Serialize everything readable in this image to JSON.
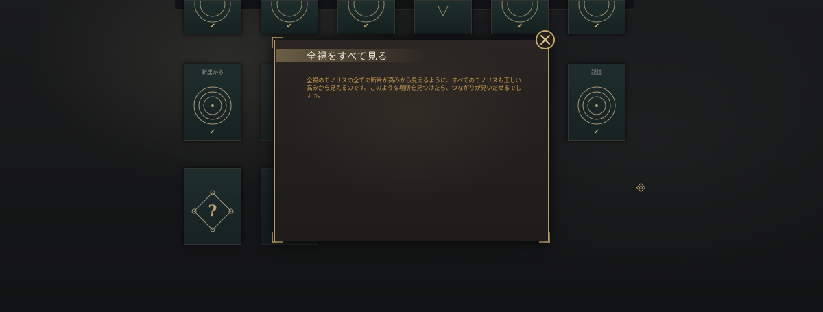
{
  "modal": {
    "title": "全視をすべて見る",
    "body": "全視のモノリスの全ての断片が高みから見えるように、すべてのモノリスも正しい高みから見えるのです。このような場所を見つけたら、つながりが見いだせるでしょう。"
  },
  "cards": {
    "left_label": "断崖から",
    "right_label": "記憶",
    "unknown_symbol": "?",
    "check_symbol": "✔"
  },
  "icons": {
    "close": "close-icon",
    "target": "target-icon",
    "check": "checkmark-icon",
    "unknown": "question-mark-icon",
    "rail_marker": "diamond-icon"
  },
  "colors": {
    "accent_gold": "#c6a86a",
    "body_text": "#c89a4f",
    "card_bg": "#1f2d2d"
  }
}
